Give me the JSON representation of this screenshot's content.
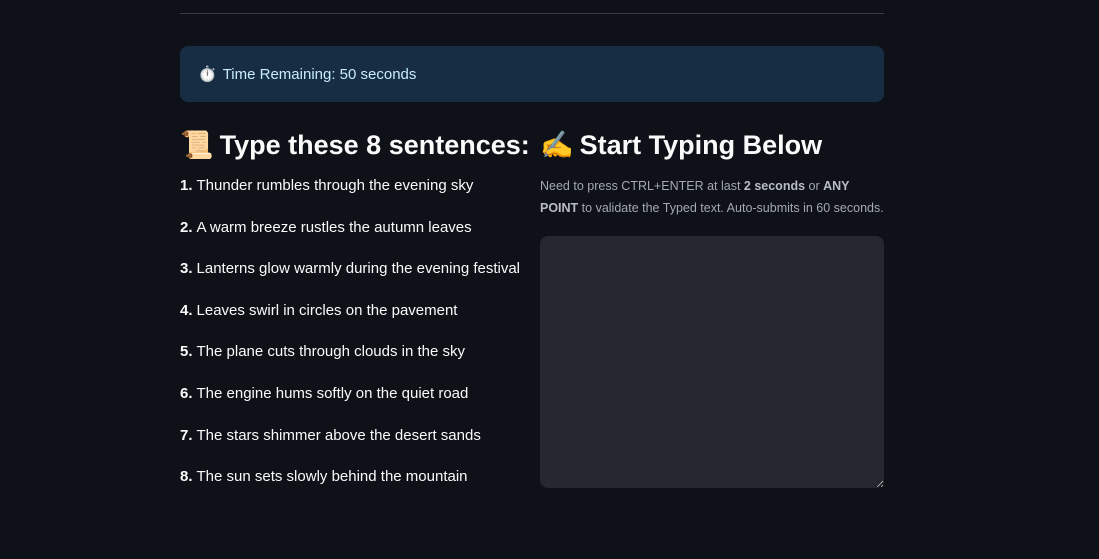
{
  "timer": {
    "icon": "⏱️",
    "text": "Time Remaining: 50 seconds"
  },
  "left": {
    "heading_icon": "📜",
    "heading": "Type these 8 sentences:",
    "sentences": [
      {
        "num": "1.",
        "text": "Thunder rumbles through the evening sky"
      },
      {
        "num": "2.",
        "text": "A warm breeze rustles the autumn leaves"
      },
      {
        "num": "3.",
        "text": "Lanterns glow warmly during the evening festival"
      },
      {
        "num": "4.",
        "text": "Leaves swirl in circles on the pavement"
      },
      {
        "num": "5.",
        "text": "The plane cuts through clouds in the sky"
      },
      {
        "num": "6.",
        "text": "The engine hums softly on the quiet road"
      },
      {
        "num": "7.",
        "text": "The stars shimmer above the desert sands"
      },
      {
        "num": "8.",
        "text": "The sun sets slowly behind the mountain"
      }
    ]
  },
  "right": {
    "heading_icon": "✍️",
    "heading": "Start Typing Below",
    "instructions": {
      "part1": "Need to press CTRL+ENTER at last ",
      "bold1": "2 seconds",
      "part2": " or ",
      "bold2": "ANY POINT",
      "part3": " to validate the Typed text. Auto-submits in 60 seconds."
    },
    "textarea_value": ""
  }
}
